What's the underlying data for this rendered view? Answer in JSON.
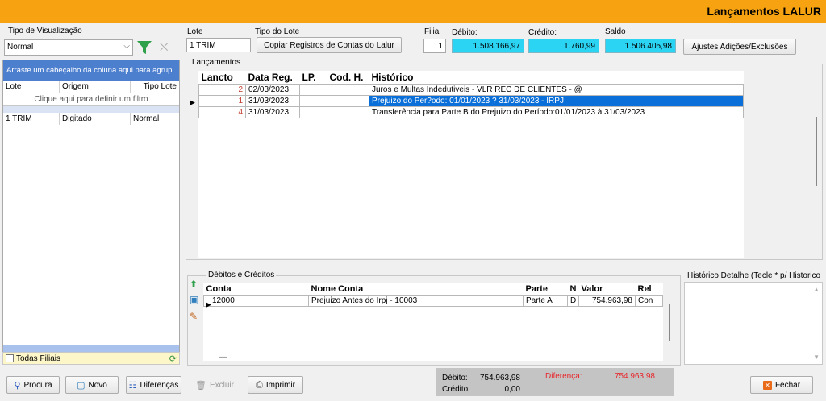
{
  "window": {
    "title": "Lançamentos LALUR"
  },
  "left": {
    "view_label": "Tipo de Visualização",
    "view_value": "Normal",
    "group_hint": "Arraste um cabeçalho da coluna aqui para agrup",
    "columns": [
      "Lote",
      "Origem",
      "Tipo Lote"
    ],
    "filter_hint": "Clique aqui para definir um filtro",
    "rows": [
      {
        "lote": "1 TRIM",
        "origem": "Digitado",
        "tipo": "Normal"
      }
    ],
    "all_branches": "Todas Filiais"
  },
  "header": {
    "lote_label": "Lote",
    "lote_value": "1 TRIM",
    "tipo_label": "Tipo do Lote",
    "copy_button": "Copiar Registros de Contas do Lalur",
    "filial_label": "Filial",
    "filial_value": "1",
    "debito_label": "Débito:",
    "debito_value": "1.508.166,97",
    "credito_label": "Crédito:",
    "credito_value": "1.760,99",
    "saldo_label": "Saldo",
    "saldo_value": "1.506.405,98",
    "ajustes_button": "Ajustes Adições/Exclusões"
  },
  "lancamentos": {
    "legend": "Lançamentos",
    "columns": [
      "Lancto",
      "Data Reg.",
      "LP.",
      "Cod. H.",
      "Histórico"
    ],
    "rows": [
      {
        "lancto": "2",
        "data": "02/03/2023",
        "lp": "",
        "cod": "",
        "hist": "Juros e Multas Indedutiveis - VLR REC DE CLIENTES - @"
      },
      {
        "lancto": "1",
        "data": "31/03/2023",
        "lp": "",
        "cod": "",
        "hist": "Prejuizo do Per?odo: 01/01/2023 ? 31/03/2023 - IRPJ"
      },
      {
        "lancto": "4",
        "data": "31/03/2023",
        "lp": "",
        "cod": "",
        "hist": "Transferência para Parte B do Prejuizo do Período:01/01/2023 à 31/03/2023"
      }
    ]
  },
  "debcred": {
    "legend": "Débitos e Créditos",
    "columns": [
      "Conta",
      "Nome Conta",
      "Parte",
      "N",
      "Valor",
      "Rel"
    ],
    "rows": [
      {
        "conta": "12000",
        "nome": "Prejuizo Antes do Irpj - 10003",
        "parte": "Parte A",
        "n": "D",
        "valor": "754.963,98",
        "rel": "Con"
      }
    ],
    "footer_mark": "—"
  },
  "historico_detalhe": {
    "legend": "Histórico Detalhe (Tecle * p/ Historico"
  },
  "toolbar": {
    "procura": "Procura",
    "novo": "Novo",
    "diferencas": "Diferenças",
    "excluir": "Excluir",
    "imprimir": "Imprimir",
    "fechar": "Fechar"
  },
  "totals": {
    "debito_label": "Débito:",
    "debito_value": "754.963,98",
    "credito_label": "Crédito",
    "credito_value": "0,00",
    "diferenca_label": "Diferença:",
    "diferenca_value": "754.963,98",
    "diff_color": "#e8262b"
  },
  "colors": {
    "title_bar": "#f7a311",
    "cyan": "#2cd4f3",
    "selection": "#0a6fd8",
    "group_bar": "#4d7fcf"
  }
}
